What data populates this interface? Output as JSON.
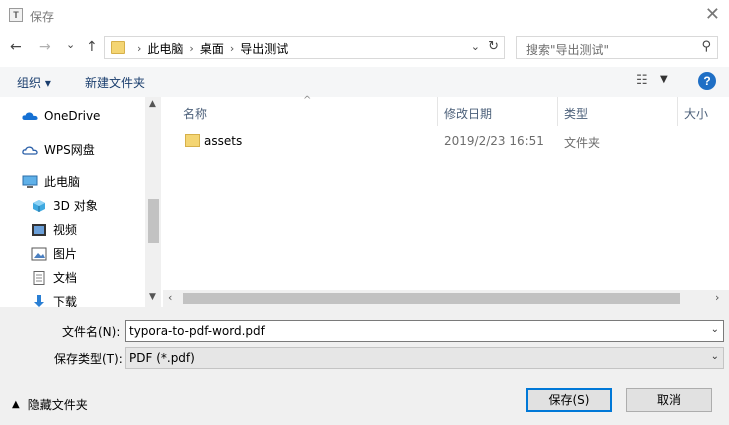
{
  "window": {
    "title": "保存",
    "app_icon_letter": "T"
  },
  "navigation": {
    "back_glyph": "←",
    "forward_glyph": "→",
    "recent_glyph": "⌄",
    "up_glyph": "↑",
    "breadcrumbs": [
      "此电脑",
      "桌面",
      "导出测试"
    ],
    "search_placeholder": "搜索\"导出测试\""
  },
  "toolbar": {
    "organize_label": "组织 ▾",
    "new_folder_label": "新建文件夹"
  },
  "sidebar": {
    "items": [
      {
        "label": "OneDrive",
        "icon": "cloud-icon"
      },
      {
        "label": "WPS网盘",
        "icon": "cloud-outline-icon"
      },
      {
        "label": "此电脑",
        "icon": "computer-icon"
      },
      {
        "label": "3D 对象",
        "icon": "cube-icon"
      },
      {
        "label": "视频",
        "icon": "video-icon"
      },
      {
        "label": "图片",
        "icon": "picture-icon"
      },
      {
        "label": "文档",
        "icon": "document-icon"
      },
      {
        "label": "下载",
        "icon": "download-icon"
      }
    ]
  },
  "file_list": {
    "columns": [
      "名称",
      "修改日期",
      "类型",
      "大小"
    ],
    "rows": [
      {
        "name": "assets",
        "modified": "2019/2/23 16:51",
        "type": "文件夹",
        "size": ""
      }
    ]
  },
  "form": {
    "filename_label": "文件名(N):",
    "filename_value": "typora-to-pdf-word.pdf",
    "type_label": "保存类型(T):",
    "type_value": "PDF (*.pdf)",
    "hide_folders_label": "隐藏文件夹",
    "save_label": "保存(S)",
    "cancel_label": "取消"
  },
  "colors": {
    "accent": "#0078d7",
    "folder": "#f4d573",
    "help": "#1f6fc5"
  }
}
